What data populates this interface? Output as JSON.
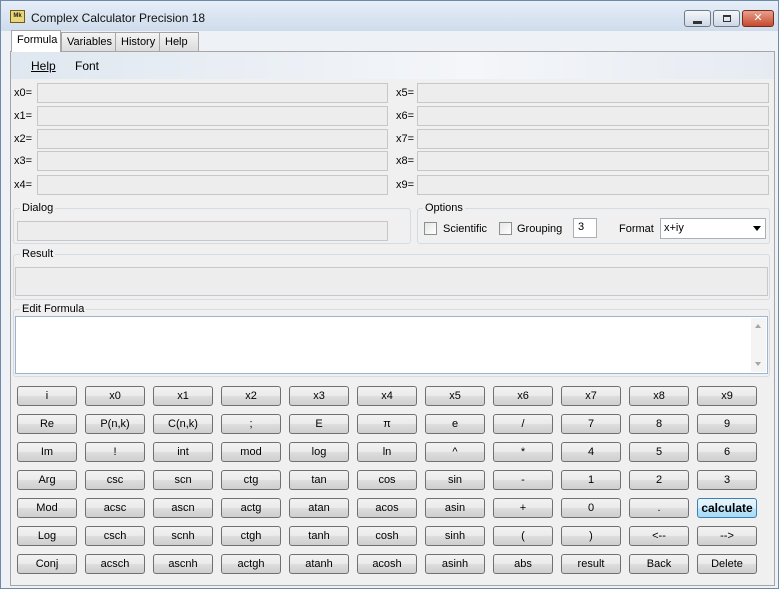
{
  "window": {
    "title": "Complex Calculator Precision 18",
    "icon_text": "Mk",
    "controls": {
      "minimize": "minimize-icon",
      "maximize": "maximize-icon",
      "close": "✕"
    }
  },
  "tabs": [
    {
      "label": "Formula",
      "active": true
    },
    {
      "label": "Variables",
      "active": false
    },
    {
      "label": "History",
      "active": false
    },
    {
      "label": "Help",
      "active": false
    }
  ],
  "menu": {
    "help": "Help",
    "font": "Font"
  },
  "variables": {
    "left": [
      {
        "label": "x0=",
        "value": ""
      },
      {
        "label": "x1=",
        "value": ""
      },
      {
        "label": "x2=",
        "value": ""
      },
      {
        "label": "x3=",
        "value": ""
      },
      {
        "label": "x4=",
        "value": ""
      }
    ],
    "right": [
      {
        "label": "x5=",
        "value": ""
      },
      {
        "label": "x6=",
        "value": ""
      },
      {
        "label": "x7=",
        "value": ""
      },
      {
        "label": "x8=",
        "value": ""
      },
      {
        "label": "x9=",
        "value": ""
      }
    ]
  },
  "dialog": {
    "title": "Dialog",
    "value": ""
  },
  "options": {
    "title": "Options",
    "scientific": {
      "label": "Scientific",
      "checked": false
    },
    "grouping": {
      "label": "Grouping",
      "checked": false
    },
    "grouping_size": "3",
    "format_label": "Format",
    "format_value": "x+iy"
  },
  "result": {
    "title": "Result",
    "value": ""
  },
  "edit_formula": {
    "title": "Edit Formula",
    "value": ""
  },
  "keypad": [
    [
      "i",
      "x0",
      "x1",
      "x2",
      "x3",
      "x4",
      "x5",
      "x6",
      "x7",
      "x8",
      "x9"
    ],
    [
      "Re",
      "P(n,k)",
      "C(n,k)",
      ";",
      "E",
      "π",
      "e",
      "/",
      "7",
      "8",
      "9"
    ],
    [
      "Im",
      "!",
      "int",
      "mod",
      "log",
      "ln",
      "^",
      "*",
      "4",
      "5",
      "6"
    ],
    [
      "Arg",
      "csc",
      "scn",
      "ctg",
      "tan",
      "cos",
      "sin",
      "-",
      "1",
      "2",
      "3"
    ],
    [
      "Mod",
      "acsc",
      "ascn",
      "actg",
      "atan",
      "acos",
      "asin",
      "+",
      "0",
      ".",
      "calculate"
    ],
    [
      "Log",
      "csch",
      "scnh",
      "ctgh",
      "tanh",
      "cosh",
      "sinh",
      "(",
      ")",
      "<--",
      "-->"
    ],
    [
      "Conj",
      "acsch",
      "ascnh",
      "actgh",
      "atanh",
      "acosh",
      "asinh",
      "abs",
      "result",
      "Back",
      "Delete"
    ]
  ],
  "colors": {
    "accent_key": "#bee6fd",
    "panel": "#f0f0f0"
  }
}
